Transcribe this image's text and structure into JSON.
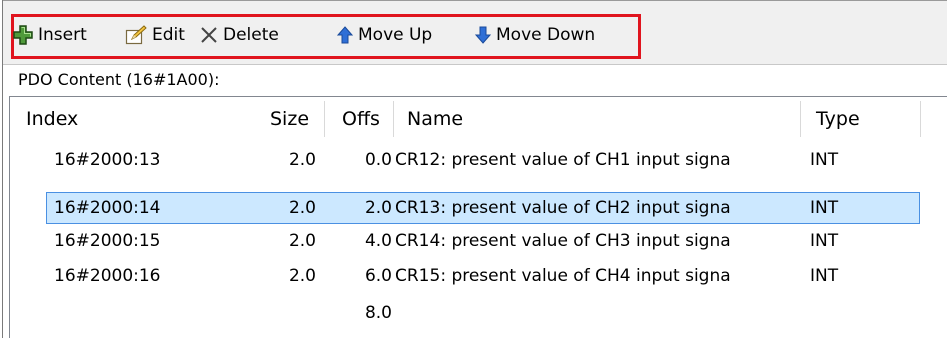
{
  "toolbar": {
    "insert_label": "Insert",
    "edit_label": "Edit",
    "delete_label": "Delete",
    "move_up_label": "Move Up",
    "move_down_label": "Move Down"
  },
  "pdo_content_label": "PDO Content (16#1A00):",
  "table": {
    "columns": [
      "Index",
      "Size",
      "Offs",
      "Name",
      "Type"
    ],
    "rows": [
      {
        "index": "16#2000:13",
        "size": "2.0",
        "offs": "0.0",
        "name": "CR12: present value of CH1 input signa",
        "type": "INT"
      },
      {
        "index": "16#2000:14",
        "size": "2.0",
        "offs": "2.0",
        "name": "CR13: present value of CH2 input signa",
        "type": "INT"
      },
      {
        "index": "16#2000:15",
        "size": "2.0",
        "offs": "4.0",
        "name": "CR14: present value of CH3 input signa",
        "type": "INT"
      },
      {
        "index": "16#2000:16",
        "size": "2.0",
        "offs": "6.0",
        "name": "CR15: present value of CH4 input signa",
        "type": "INT"
      },
      {
        "index": "",
        "size": "",
        "offs": "8.0",
        "name": "",
        "type": ""
      }
    ],
    "selected_row": 1
  },
  "colors": {
    "highlight_border": "#e0141e",
    "selection_fill": "#cce8ff",
    "selection_border": "#4a90e2",
    "insert_icon": "#3a7a2a",
    "arrow_icon": "#2f6fd6"
  },
  "icons": {
    "insert": "plus-icon",
    "edit": "pencil-icon",
    "delete": "x-icon",
    "move_up": "arrow-up-icon",
    "move_down": "arrow-down-icon"
  }
}
